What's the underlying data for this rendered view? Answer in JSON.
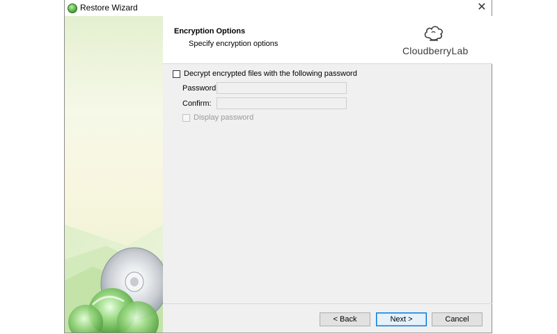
{
  "window": {
    "title": "Restore Wizard",
    "close_glyph": "✕"
  },
  "header": {
    "title": "Encryption Options",
    "subtitle": "Specify encryption options",
    "logo_text": "CloudberryLab",
    "logo_icon": "cloud-icon"
  },
  "form": {
    "decrypt_checkbox": {
      "label": "Decrypt encrypted files with the following password",
      "checked": false
    },
    "password": {
      "label": "Password:",
      "value": "",
      "disabled": true
    },
    "confirm": {
      "label": "Confirm:",
      "value": "",
      "disabled": true
    },
    "display_password": {
      "label": "Display password",
      "checked": false,
      "disabled": true
    }
  },
  "buttons": {
    "back": "< Back",
    "next": "Next >",
    "cancel": "Cancel"
  },
  "colors": {
    "accent": "#0078d7",
    "sidebar_green": "#6fbf5a",
    "window_bg": "#f0f0f0"
  }
}
